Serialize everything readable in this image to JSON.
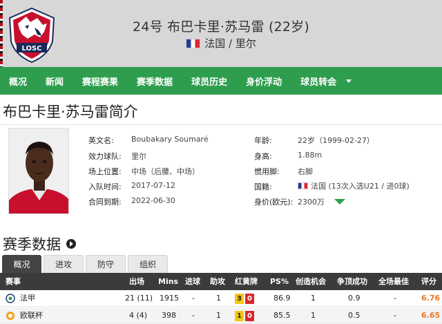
{
  "header": {
    "title": "24号 布巴卡里·苏马雷 (22岁)",
    "nation": "法国 / 里尔",
    "logo_text": "LOSC"
  },
  "nav": {
    "items": [
      "概况",
      "新闻",
      "赛程赛果",
      "赛季数据",
      "球员历史",
      "身价浮动",
      "球员转会"
    ]
  },
  "bio": {
    "title": "布巴卡里·苏马雷简介",
    "left": [
      {
        "label": "英文名:",
        "value": "Boubakary Soumaré"
      },
      {
        "label": "效力球队:",
        "value": "里尔"
      },
      {
        "label": "场上位置:",
        "value": "中场（后腰、中场）"
      },
      {
        "label": "入队时间:",
        "value": "2017-07-12"
      },
      {
        "label": "合同到期:",
        "value": "2022-06-30"
      }
    ],
    "right": [
      {
        "label": "年龄:",
        "value": "22岁（1999-02-27）"
      },
      {
        "label": "身高:",
        "value": "1.88m"
      },
      {
        "label": "惯用脚:",
        "value": "右脚"
      },
      {
        "label": "国籍:",
        "value": "法国 (13次入选U21 / 进0球)"
      },
      {
        "label": "身价(欧元):",
        "value": "2300万"
      }
    ]
  },
  "stats": {
    "title": "赛季数据",
    "tabs": [
      "概况",
      "进攻",
      "防守",
      "组织"
    ],
    "columns": [
      "赛事",
      "出场",
      "Mins",
      "进球",
      "助攻",
      "红黄牌",
      "PS%",
      "创造机会",
      "争顶成功",
      "全场最佳",
      "评分"
    ],
    "rows": [
      {
        "competition": "法甲",
        "apps": "21 (11)",
        "mins": "1915",
        "goals": "-",
        "assists": "1",
        "yellow": "3",
        "red": "0",
        "ps": "86.9",
        "chances": "1",
        "aerials": "0.9",
        "motm": "-",
        "rating": "6.76"
      },
      {
        "competition": "欧联杯",
        "apps": "4 (4)",
        "mins": "398",
        "goals": "-",
        "assists": "1",
        "yellow": "1",
        "red": "0",
        "ps": "85.5",
        "chances": "1",
        "aerials": "0.5",
        "motm": "-",
        "rating": "6.65"
      }
    ]
  },
  "colors": {
    "nav_green": "#2e9e4e",
    "header_gray": "#d7d7d7",
    "rating_orange": "#e87722",
    "yellow_card": "#f2c80f",
    "red_card": "#d8262c"
  }
}
